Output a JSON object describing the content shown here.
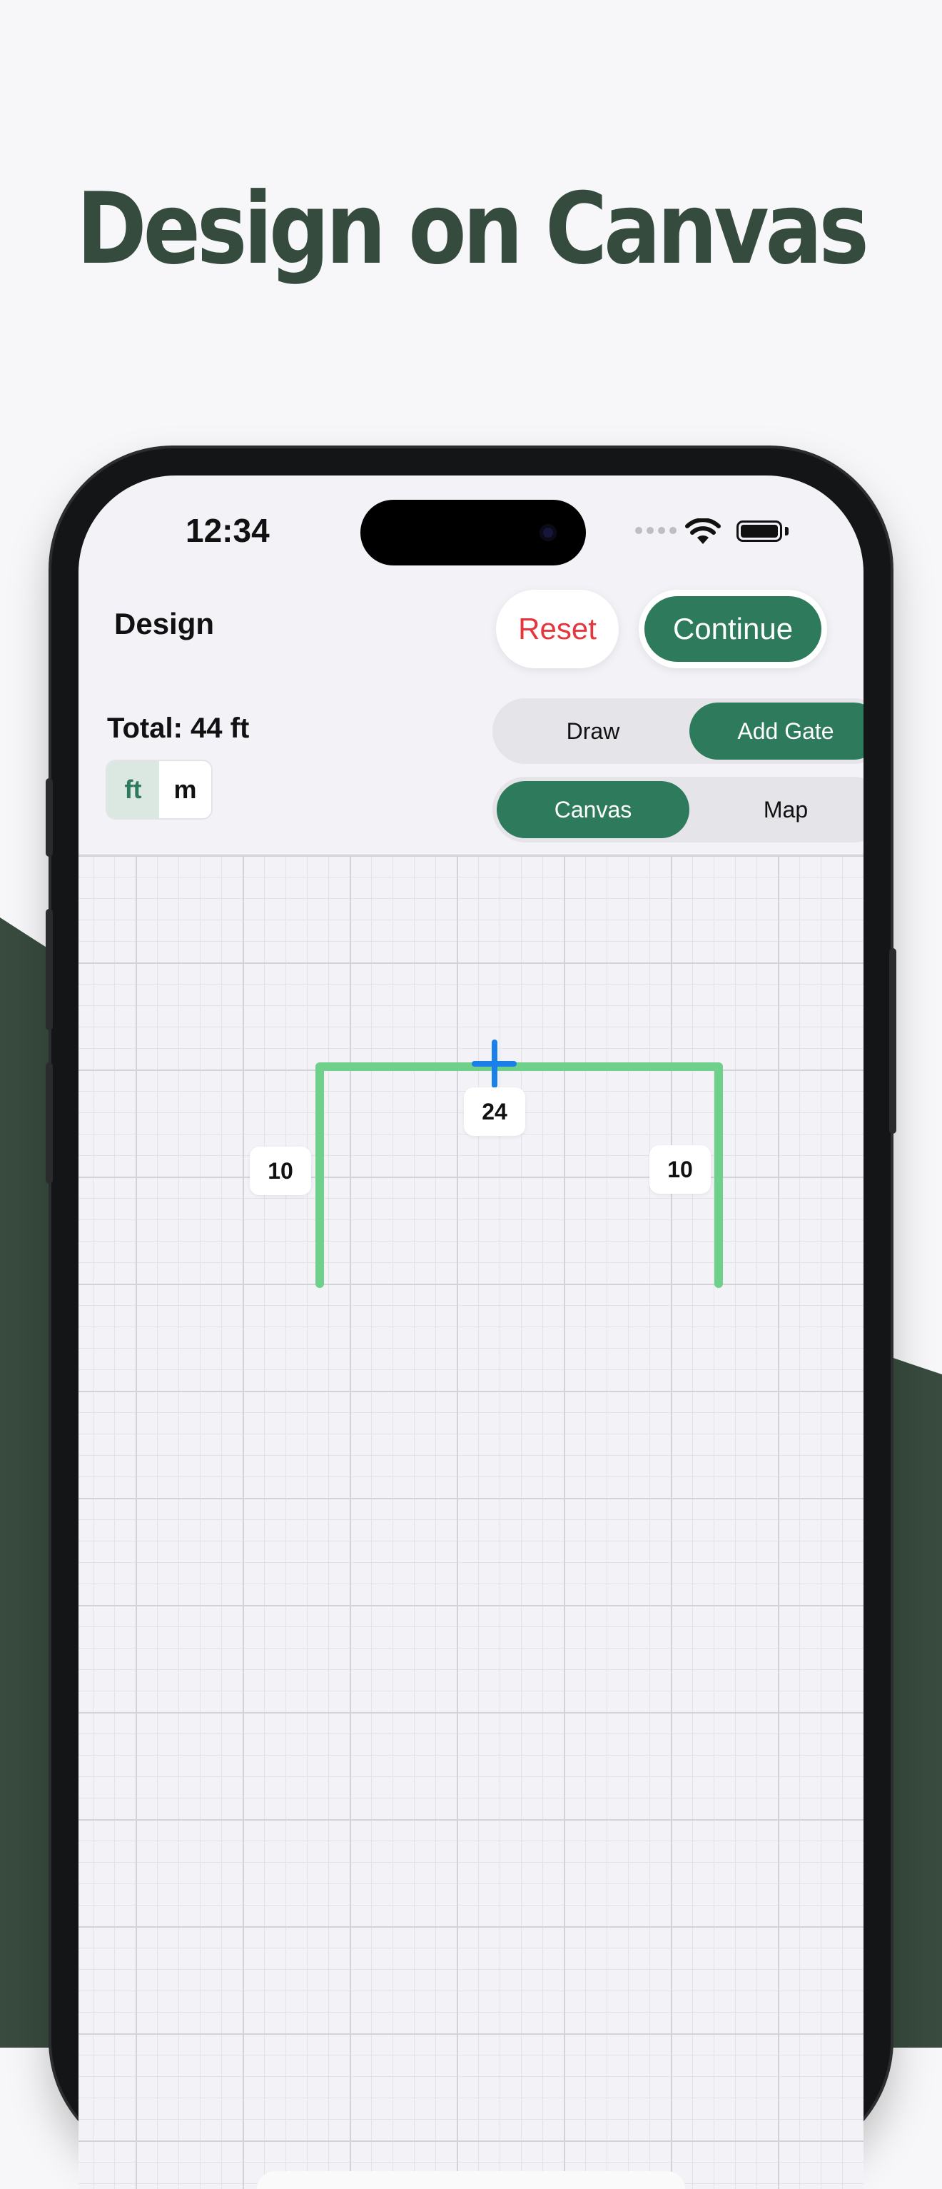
{
  "headline": "Design on Canvas",
  "colors": {
    "brand_dark": "#354b3e",
    "accent_green": "#2d7a5c",
    "fence_line": "#6fd08c",
    "gate_marker": "#1a7fe8",
    "reset_red": "#e5363d"
  },
  "status_bar": {
    "time": "12:34"
  },
  "nav": {
    "title": "Design",
    "reset_label": "Reset",
    "continue_label": "Continue"
  },
  "summary": {
    "total": "Total: 44 ft"
  },
  "units": {
    "options": [
      "ft",
      "m"
    ],
    "selected": "ft"
  },
  "mode_toggle": {
    "options": [
      "Draw",
      "Add Gate"
    ],
    "selected": "Add Gate"
  },
  "view_toggle": {
    "options": [
      "Canvas",
      "Map"
    ],
    "selected": "Canvas"
  },
  "canvas": {
    "segments": [
      {
        "side": "left",
        "length_label": "10"
      },
      {
        "side": "top",
        "length_label": "24"
      },
      {
        "side": "right",
        "length_label": "10"
      }
    ],
    "gate_marker_icon": "crosshair-plus-icon"
  }
}
